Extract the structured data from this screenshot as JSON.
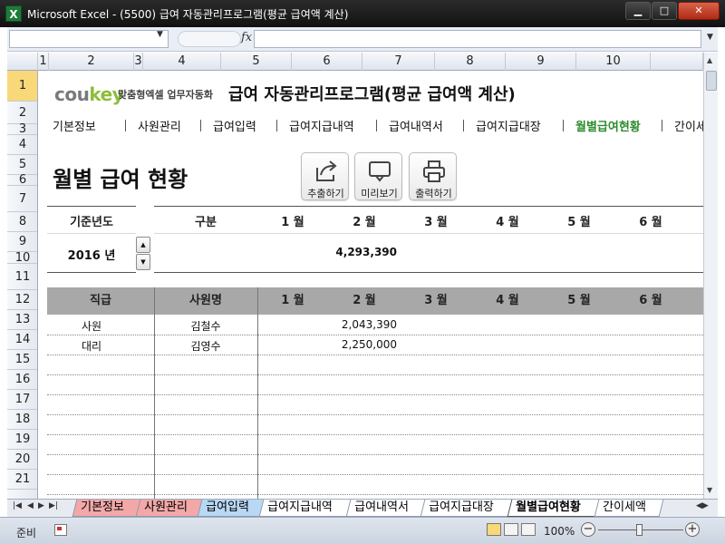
{
  "window": {
    "app_icon_letter": "X",
    "title": "Microsoft Excel - (5500) 급여 자동관리프로그램(평균 급여액 계산)",
    "minimize": "▁",
    "maximize": "□",
    "close": "✕"
  },
  "formula_bar": {
    "name_box": "",
    "fx_label": "fx",
    "formula": ""
  },
  "columns": [
    "1",
    "2",
    "3",
    "4",
    "5",
    "6",
    "7",
    "8",
    "9",
    "10"
  ],
  "rows": [
    "1",
    "2",
    "3",
    "4",
    "5",
    "6",
    "7",
    "8",
    "9",
    "10",
    "11",
    "12",
    "13",
    "14",
    "15",
    "16",
    "17",
    "18",
    "19",
    "20",
    "21"
  ],
  "brand": {
    "logo_left": "cou",
    "logo_right": "key",
    "tagline": "맞춤형엑셀 업무자동화",
    "program_title": "급여 자동관리프로그램(평균 급여액 계산)"
  },
  "nav": {
    "items": [
      {
        "label": "기본정보"
      },
      {
        "label": "사원관리"
      },
      {
        "label": "급여입력"
      },
      {
        "label": "급여지급내역"
      },
      {
        "label": "급여내역서"
      },
      {
        "label": "급여지급대장"
      },
      {
        "label": "월별급여현황"
      },
      {
        "label": "간이세"
      }
    ],
    "active_index": 6,
    "active_color": "#2e8b2e"
  },
  "page": {
    "heading": "월별 급여 현황",
    "buttons": [
      {
        "label": "추출하기",
        "icon": "export-icon"
      },
      {
        "label": "미리보기",
        "icon": "monitor-icon"
      },
      {
        "label": "출력하기",
        "icon": "printer-icon"
      }
    ]
  },
  "criteria": {
    "year_header": "기준년도",
    "year_value": "2016 년",
    "category_header": "구분",
    "months": [
      "1 월",
      "2 월",
      "3 월",
      "4 월",
      "5 월",
      "6 월"
    ],
    "totals": [
      "",
      "4,293,390",
      "",
      "",
      "",
      ""
    ]
  },
  "table": {
    "headers": {
      "rank": "직급",
      "name": "사원명"
    },
    "months": [
      "1 월",
      "2 월",
      "3 월",
      "4 월",
      "5 월",
      "6 월"
    ],
    "rows": [
      {
        "rank": "사원",
        "name": "김철수",
        "values": [
          "",
          "2,043,390",
          "",
          "",
          "",
          ""
        ]
      },
      {
        "rank": "대리",
        "name": "김영수",
        "values": [
          "",
          "2,250,000",
          "",
          "",
          "",
          ""
        ]
      }
    ]
  },
  "sheet_tabs": [
    {
      "label": "기본정보",
      "color": "#f3a8a8"
    },
    {
      "label": "사원관리",
      "color": "#f3a8a8"
    },
    {
      "label": "급여입력",
      "color": "#b8d8f5"
    },
    {
      "label": "급여지급내역",
      "color": "#ffffff"
    },
    {
      "label": "급여내역서",
      "color": "#ffffff"
    },
    {
      "label": "급여지급대장",
      "color": "#ffffff"
    },
    {
      "label": "월별급여현황",
      "color": "#ffffff"
    },
    {
      "label": "간이세액",
      "color": "#ffffff"
    }
  ],
  "status": {
    "ready": "준비",
    "zoom": "100%",
    "zoom_minus": "−",
    "zoom_plus": "+"
  }
}
